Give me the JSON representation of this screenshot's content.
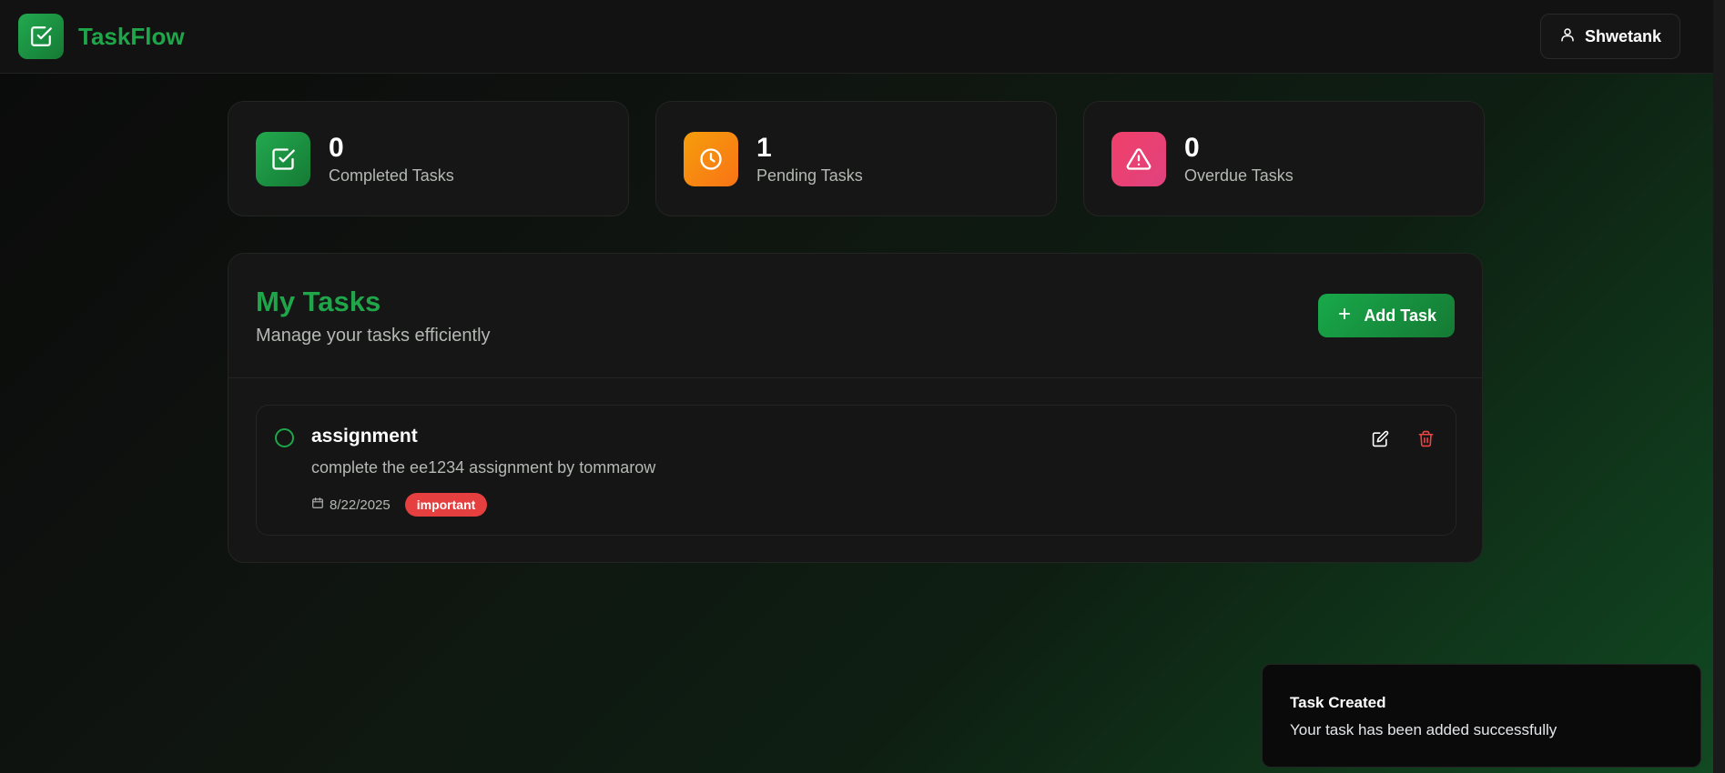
{
  "app": {
    "name": "TaskFlow"
  },
  "header": {
    "user_name": "Shwetank"
  },
  "stats": [
    {
      "value": "0",
      "label": "Completed Tasks",
      "color": "#1fa64a",
      "icon": "check-square-icon"
    },
    {
      "value": "1",
      "label": "Pending Tasks",
      "color": "#f59e0b",
      "icon": "clock-icon"
    },
    {
      "value": "0",
      "label": "Overdue Tasks",
      "color": "#ec4a6d",
      "icon": "alert-triangle-icon"
    }
  ],
  "tasks_panel": {
    "title": "My Tasks",
    "subtitle": "Manage your tasks efficiently",
    "add_button_label": "Add Task"
  },
  "tasks": [
    {
      "title": "assignment",
      "description": "complete the ee1234 assignment by tommarow",
      "date": "8/22/2025",
      "tag": "important",
      "tag_color": "#e5403f"
    }
  ],
  "toast": {
    "title": "Task Created",
    "message": "Your task has been added successfully"
  }
}
